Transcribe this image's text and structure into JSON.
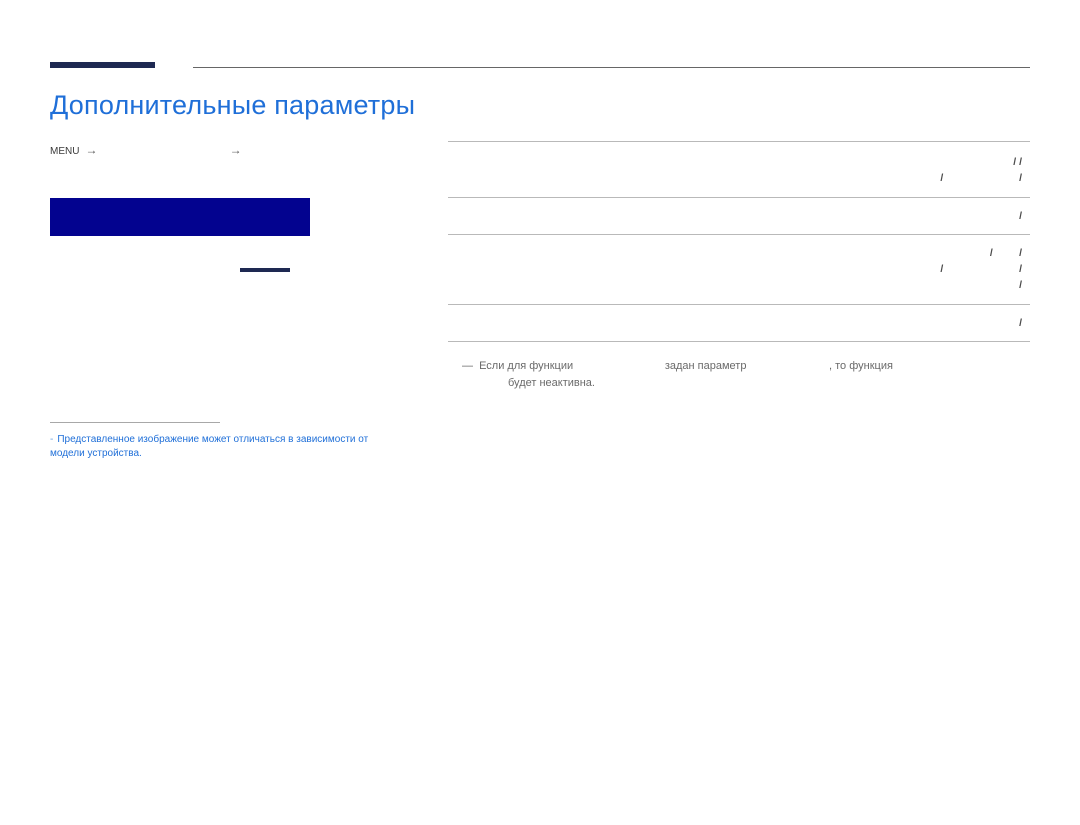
{
  "heading": "Дополнительные параметры",
  "nav": {
    "menu": "MENU",
    "a1": "→",
    "a2": "→"
  },
  "footnote": "Представленное изображение может отличаться в зависимости от модели устройства.",
  "note": {
    "p1": "Если для функции ",
    "p2": " задан параметр ",
    "p3": ", то функция ",
    "p4": " будет неактивна."
  },
  "params": [
    {
      "key": "",
      "desc": "",
      "opts": [
        "",
        "",
        ""
      ],
      "lines2": [
        "",
        "",
        "",
        ""
      ]
    },
    {
      "key": "",
      "desc": "",
      "opts": [
        "",
        ""
      ]
    },
    {
      "key": "",
      "desc": "",
      "opts": [
        "",
        "",
        ""
      ],
      "lines2": [
        "",
        "",
        "",
        ""
      ]
    },
    {
      "key": "",
      "desc": "",
      "opts": [
        "",
        ""
      ]
    }
  ]
}
